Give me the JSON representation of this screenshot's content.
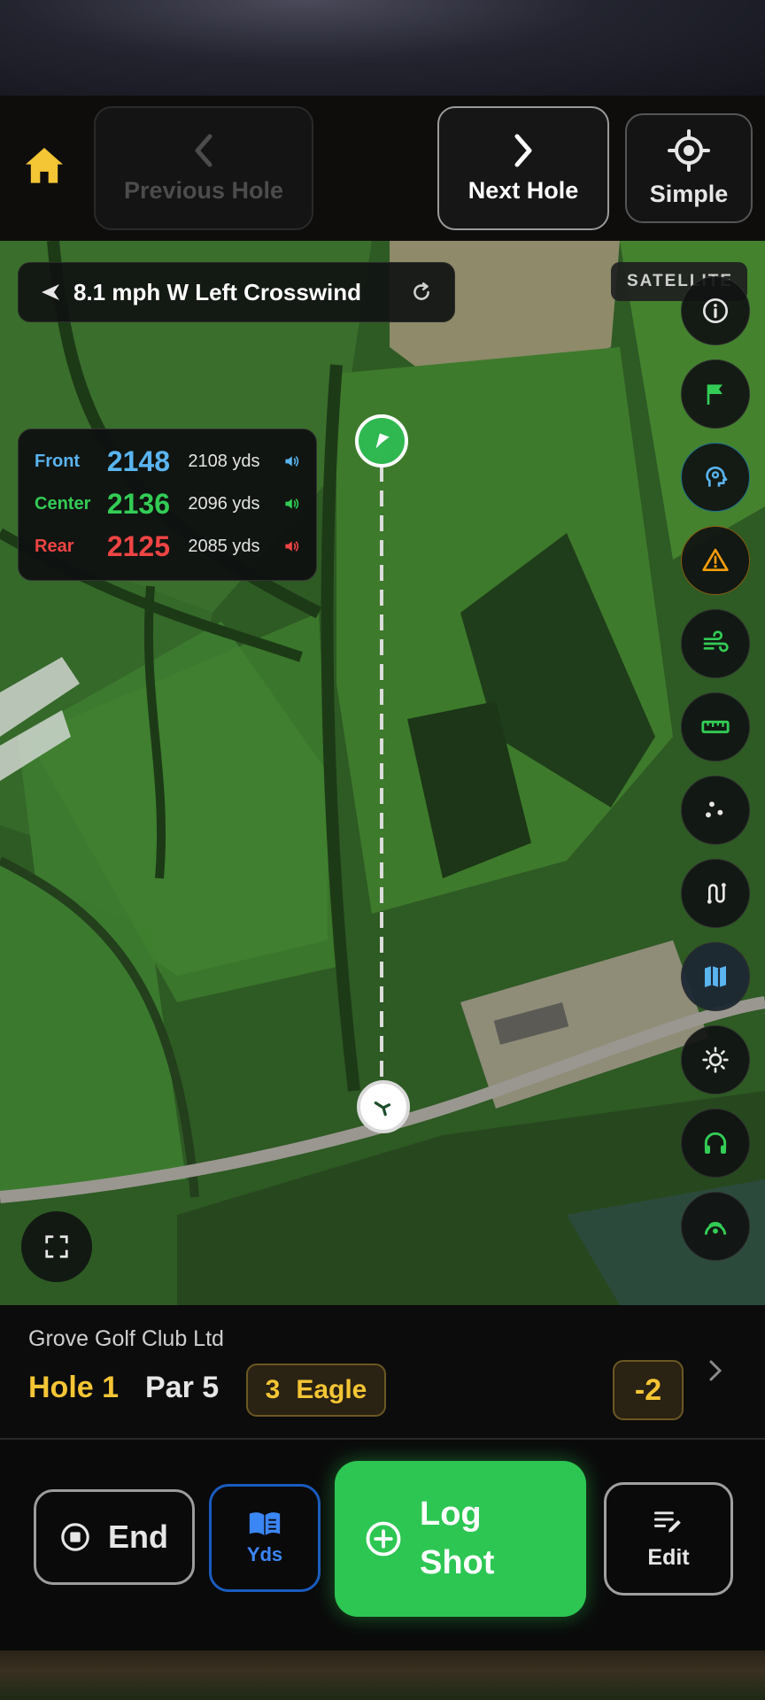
{
  "header": {
    "prev_label": "Previous Hole",
    "next_label": "Next Hole",
    "simple_label": "Simple"
  },
  "map": {
    "wind_text": "8.1 mph W  Left Crosswind",
    "satellite_label": "SATELLITE",
    "distances": [
      {
        "label": "Front",
        "value": "2148",
        "yds": "2108 yds",
        "color": "#5ab4f0"
      },
      {
        "label": "Center",
        "value": "2136",
        "yds": "2096 yds",
        "color": "#33cc55"
      },
      {
        "label": "Rear",
        "value": "2125",
        "yds": "2085 yds",
        "color": "#ef4444"
      }
    ],
    "side_tools": [
      "info-icon",
      "flag-icon",
      "caddie-icon",
      "hazard-icon",
      "wind-icon",
      "ruler-icon",
      "dots-icon",
      "route-icon",
      "map-icon",
      "brightness-icon",
      "headphones-icon",
      "voice-icon"
    ]
  },
  "hole": {
    "course_name": "Grove Golf Club Ltd",
    "hole_label": "Hole 1",
    "par_label": "Par 5",
    "score": "3",
    "score_name": "Eagle",
    "total": "-2"
  },
  "actions": {
    "end_label": "End",
    "yds_label": "Yds",
    "log_line1": "Log",
    "log_line2": "Shot",
    "edit_label": "Edit"
  },
  "colors": {
    "accent_gold": "#f4c534",
    "accent_green": "#2dc653",
    "accent_blue": "#3b86f5"
  }
}
